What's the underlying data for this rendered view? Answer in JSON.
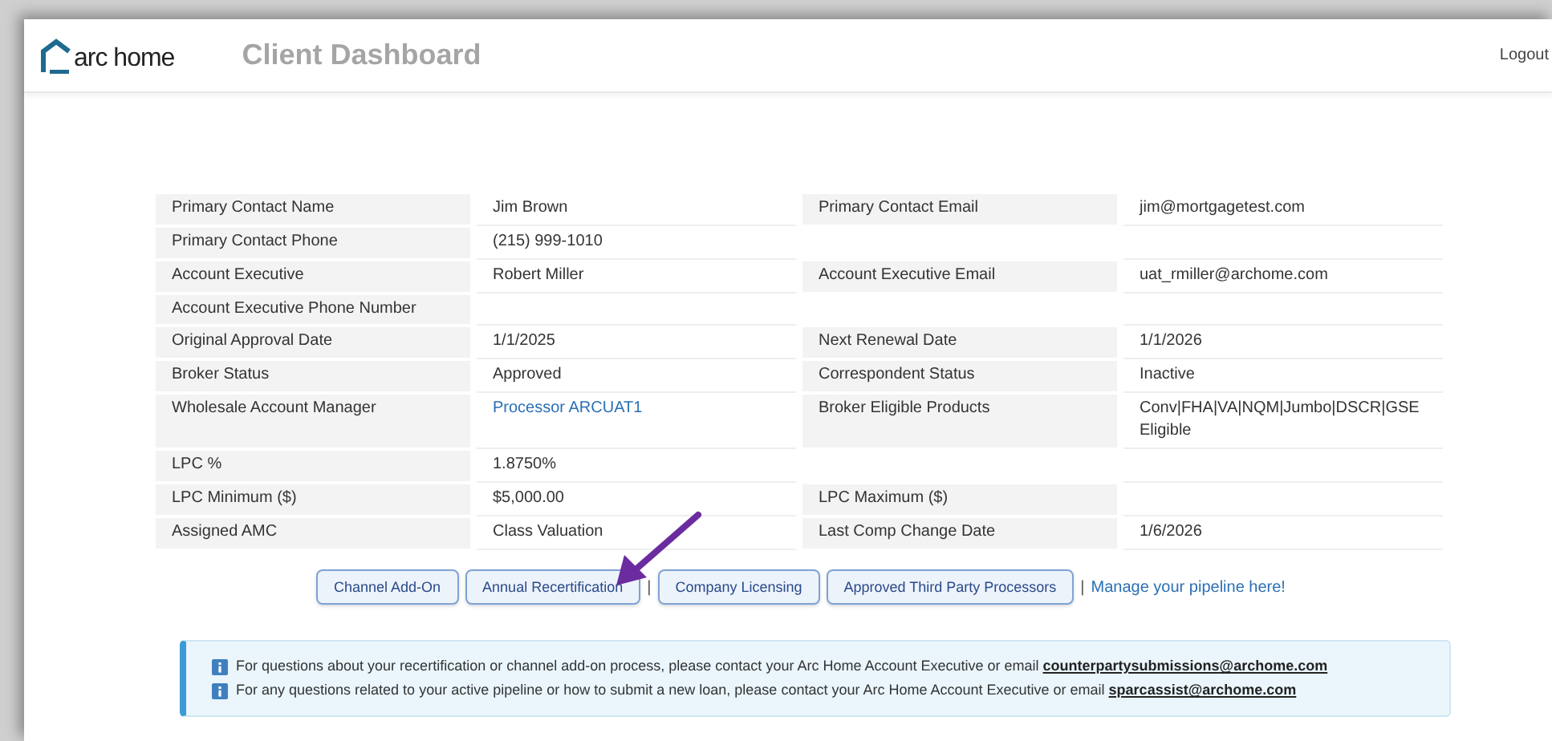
{
  "header": {
    "logo": "arc home",
    "title": "Client Dashboard",
    "logout": "Logout"
  },
  "details": [
    {
      "cells": [
        {
          "label": "Primary Contact Name",
          "value": "Jim Brown"
        },
        {
          "label": "Primary Contact Email",
          "value": "jim@mortgagetest.com"
        }
      ]
    },
    {
      "cells": [
        {
          "label": "Primary Contact Phone",
          "value": "(215) 999-1010"
        }
      ]
    },
    {
      "cells": [
        {
          "label": "Account Executive",
          "value": "Robert Miller"
        },
        {
          "label": "Account Executive Email",
          "value": "uat_rmiller@archome.com"
        }
      ]
    },
    {
      "cells": [
        {
          "label": "Account Executive Phone Number"
        }
      ]
    },
    {
      "cells": [
        {
          "label": "Original Approval Date",
          "value": "1/1/2025"
        },
        {
          "label": "Next Renewal Date",
          "value": "1/1/2026"
        }
      ]
    },
    {
      "cells": [
        {
          "label": "Broker Status",
          "value": "Approved"
        },
        {
          "label": "Correspondent Status",
          "value": "Inactive"
        }
      ]
    },
    {
      "cells": [
        {
          "label": "Wholesale Account Manager",
          "value": "Processor ARCUAT1",
          "kind": "link"
        },
        {
          "label": "Broker Eligible Products",
          "value": "Conv|FHA|VA|NQM|Jumbo|DSCR|GSE Eligible"
        }
      ]
    },
    {
      "cells": [
        {
          "label": "LPC %",
          "value": "1.8750%"
        }
      ]
    },
    {
      "cells": [
        {
          "label": "LPC Minimum ($)",
          "value": "$5,000.00"
        },
        {
          "label": "LPC Maximum ($)"
        }
      ]
    },
    {
      "cells": [
        {
          "label": "Assigned AMC",
          "value": "Class Valuation"
        },
        {
          "label": "Last Comp Change Date",
          "value": "1/6/2026"
        }
      ]
    }
  ],
  "actions": [
    {
      "kind": "button",
      "label": "Channel Add-On"
    },
    {
      "kind": "button",
      "label": "Annual Recertification"
    },
    {
      "kind": "separator",
      "label": "|"
    },
    {
      "kind": "button",
      "label": "Company Licensing"
    },
    {
      "kind": "button",
      "label": "Approved Third Party Processors"
    },
    {
      "kind": "separator",
      "label": "|"
    },
    {
      "kind": "link",
      "label": "Manage your pipeline here!"
    }
  ],
  "notices": [
    {
      "text": "For questions about your recertification or channel add-on process, please contact your Arc Home Account Executive or email",
      "email": "counterpartysubmissions@archome.com"
    },
    {
      "text": "For any questions related to your active pipeline or how to submit a new loan, please contact your Arc Home Account Executive or email",
      "email": "sparcassist@archome.com"
    }
  ]
}
